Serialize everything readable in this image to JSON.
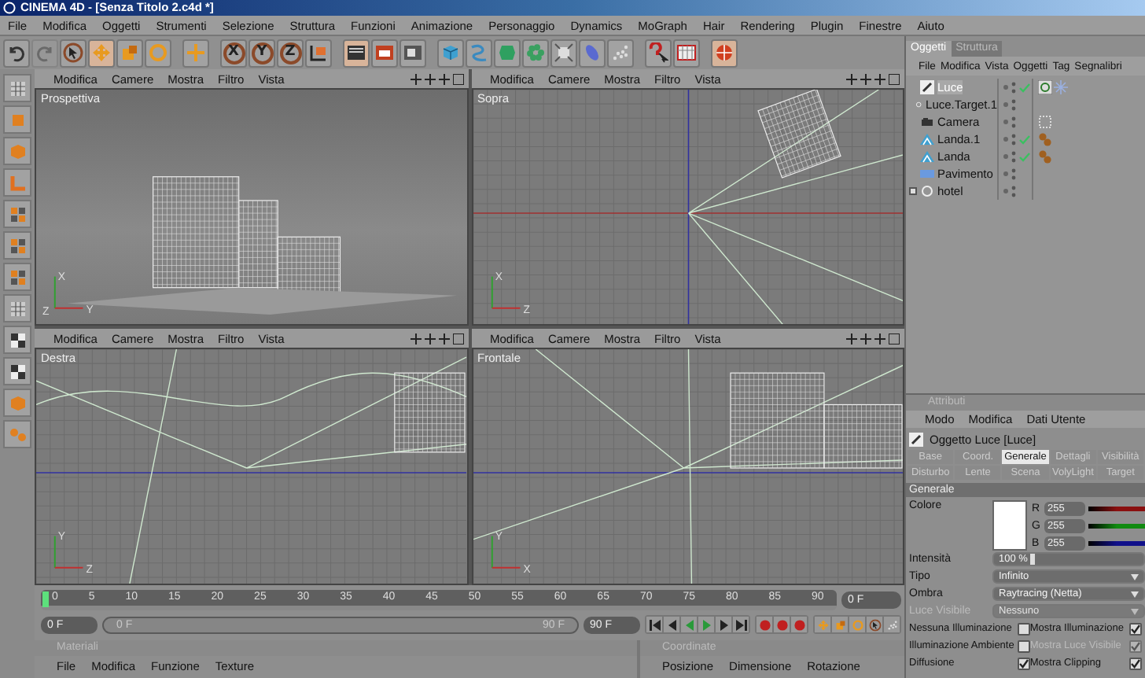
{
  "window": {
    "title": "CINEMA 4D - [Senza Titolo 2.c4d *]"
  },
  "menu": [
    "File",
    "Modifica",
    "Oggetti",
    "Strumenti",
    "Selezione",
    "Struttura",
    "Funzioni",
    "Animazione",
    "Personaggio",
    "Dynamics",
    "MoGraph",
    "Hair",
    "Rendering",
    "Plugin",
    "Finestre",
    "Aiuto"
  ],
  "tool_groups": [
    [
      {
        "kind": "undo",
        "selected": false,
        "disabled": false
      },
      {
        "kind": "redo",
        "selected": false,
        "disabled": true
      },
      {
        "kind": "pointer",
        "selected": false,
        "disabled": false
      },
      {
        "kind": "move",
        "selected": true,
        "disabled": false
      },
      {
        "kind": "scale",
        "selected": false,
        "disabled": false
      },
      {
        "kind": "rotate",
        "selected": false,
        "disabled": false
      }
    ],
    [
      {
        "kind": "add",
        "selected": false,
        "disabled": false
      }
    ],
    [
      {
        "kind": "axis",
        "label": "X",
        "selected": false,
        "disabled": false
      },
      {
        "kind": "axis",
        "label": "Y",
        "selected": false,
        "disabled": false
      },
      {
        "kind": "axis",
        "label": "Z",
        "selected": false,
        "disabled": false
      },
      {
        "kind": "coords",
        "selected": false,
        "disabled": false
      }
    ],
    [
      {
        "kind": "render",
        "selected": true,
        "disabled": false
      },
      {
        "kind": "render-active",
        "selected": false,
        "disabled": false
      },
      {
        "kind": "render-settings",
        "selected": false,
        "disabled": false
      }
    ],
    [
      {
        "kind": "cube",
        "selected": false,
        "disabled": false
      },
      {
        "kind": "spline",
        "selected": false,
        "disabled": false
      },
      {
        "kind": "nurbs",
        "selected": false,
        "disabled": false
      },
      {
        "kind": "array",
        "selected": false,
        "disabled": false
      },
      {
        "kind": "deformer",
        "selected": false,
        "disabled": false
      },
      {
        "kind": "scene",
        "selected": false,
        "disabled": false
      },
      {
        "kind": "particles",
        "selected": false,
        "disabled": false
      }
    ],
    [
      {
        "kind": "help",
        "selected": false,
        "disabled": false
      },
      {
        "kind": "table",
        "selected": false,
        "disabled": false
      }
    ],
    [
      {
        "kind": "globe",
        "selected": true,
        "disabled": false
      }
    ]
  ],
  "viewports": [
    {
      "kind": "perspective",
      "label": "Prospettiva",
      "menu": [
        "Modifica",
        "Camere",
        "Mostra",
        "Filtro",
        "Vista"
      ],
      "axes": [
        "X",
        "Z",
        "Y"
      ]
    },
    {
      "kind": "top",
      "label": "Sopra",
      "menu": [
        "Modifica",
        "Camere",
        "Mostra",
        "Filtro",
        "Vista"
      ],
      "axes": [
        "X",
        "Z"
      ]
    },
    {
      "kind": "right",
      "label": "Destra",
      "menu": [
        "Modifica",
        "Camere",
        "Mostra",
        "Filtro",
        "Vista"
      ],
      "axes": [
        "Y",
        "Z"
      ]
    },
    {
      "kind": "front",
      "label": "Frontale",
      "menu": [
        "Modifica",
        "Camere",
        "Mostra",
        "Filtro",
        "Vista"
      ],
      "axes": [
        "Y",
        "X"
      ]
    }
  ],
  "timeline": {
    "ticks": [
      "0",
      "5",
      "10",
      "15",
      "20",
      "25",
      "30",
      "35",
      "40",
      "45",
      "50",
      "55",
      "60",
      "65",
      "70",
      "75",
      "80",
      "85",
      "90"
    ],
    "level": 0,
    "frame_field": "0 F",
    "start_field": "0 F",
    "range": {
      "start": "0 F",
      "end": "90 F",
      "level": 1
    },
    "end_field": "90 F"
  },
  "materials": {
    "title": "Materiali",
    "menu": [
      "File",
      "Modifica",
      "Funzione",
      "Texture"
    ]
  },
  "coordinates": {
    "title": "Coordinate",
    "columns": [
      "Posizione",
      "Dimensione",
      "Rotazione"
    ]
  },
  "object_manager": {
    "tabs": [
      {
        "label": "Oggetti",
        "selected": true
      },
      {
        "label": "Struttura",
        "selected": false
      }
    ],
    "menu": [
      "File",
      "Modifica",
      "Vista",
      "Oggetti",
      "Tag",
      "Segnalibri"
    ],
    "objects": [
      {
        "name": "Luce",
        "kind": "light",
        "selected": true,
        "checked": true,
        "expandable": false,
        "tags": [
          {
            "kind": "target"
          },
          {
            "kind": "light"
          }
        ]
      },
      {
        "name": "Luce.Target.1",
        "kind": "null",
        "selected": false,
        "checked": false,
        "expandable": false
      },
      {
        "name": "Camera",
        "kind": "camera",
        "selected": false,
        "checked": false,
        "expandable": false,
        "tags": [
          {
            "kind": "display"
          }
        ]
      },
      {
        "name": "Landa.1",
        "kind": "landscape",
        "selected": false,
        "checked": true,
        "expandable": false,
        "tags": [
          {
            "kind": "material"
          }
        ]
      },
      {
        "name": "Landa",
        "kind": "landscape",
        "selected": false,
        "checked": true,
        "expandable": false,
        "tags": [
          {
            "kind": "material"
          }
        ]
      },
      {
        "name": "Pavimento",
        "kind": "floor",
        "selected": false,
        "checked": false,
        "expandable": false
      },
      {
        "name": "hotel",
        "kind": "null",
        "selected": false,
        "checked": false,
        "expandable": true
      }
    ]
  },
  "attributes": {
    "title": "Attributi",
    "menu": [
      "Modo",
      "Modifica",
      "Dati Utente"
    ],
    "object": "Oggetto Luce [Luce]",
    "tabs": [
      [
        {
          "label": "Base",
          "selected": false
        },
        {
          "label": "Coord.",
          "selected": false
        },
        {
          "label": "Generale",
          "selected": true
        },
        {
          "label": "Dettagli",
          "selected": false
        },
        {
          "label": "Visibilità",
          "selected": false
        }
      ],
      [
        {
          "label": "Disturbo",
          "selected": false
        },
        {
          "label": "Lente",
          "selected": false
        },
        {
          "label": "Scena",
          "selected": false
        },
        {
          "label": "VolyLight",
          "selected": false
        },
        {
          "label": "Target",
          "selected": false
        }
      ]
    ],
    "section": "Generale",
    "color": {
      "label": "Colore",
      "channels": [
        {
          "name": "R",
          "value": "255",
          "color": "#8a1010"
        },
        {
          "name": "G",
          "value": "255",
          "color": "#108a10"
        },
        {
          "name": "B",
          "value": "255",
          "color": "#10108a"
        }
      ]
    },
    "fields": [
      {
        "label": "Intensità",
        "value": "100 %",
        "kind": "number",
        "disabled": false
      },
      {
        "label": "Tipo",
        "value": "Infinito",
        "kind": "dropdown",
        "disabled": false
      },
      {
        "label": "Ombra",
        "value": "Raytracing (Netta)",
        "kind": "dropdown",
        "disabled": false
      },
      {
        "label": "Luce Visibile",
        "value": "Nessuno",
        "kind": "dropdown",
        "disabled": true
      }
    ],
    "checks": [
      {
        "label": "Nessuna Illuminazione",
        "checked": false,
        "disabled": false
      },
      {
        "label": "Mostra Illuminazione",
        "checked": true,
        "disabled": false
      },
      {
        "label": "Illuminazione Ambiente",
        "checked": false,
        "disabled": false
      },
      {
        "label": "Mostra Luce Visibile",
        "checked": true,
        "disabled": true
      },
      {
        "label": "Diffusione",
        "checked": true,
        "disabled": false
      },
      {
        "label": "Mostra Clipping",
        "checked": true,
        "disabled": false
      }
    ]
  }
}
